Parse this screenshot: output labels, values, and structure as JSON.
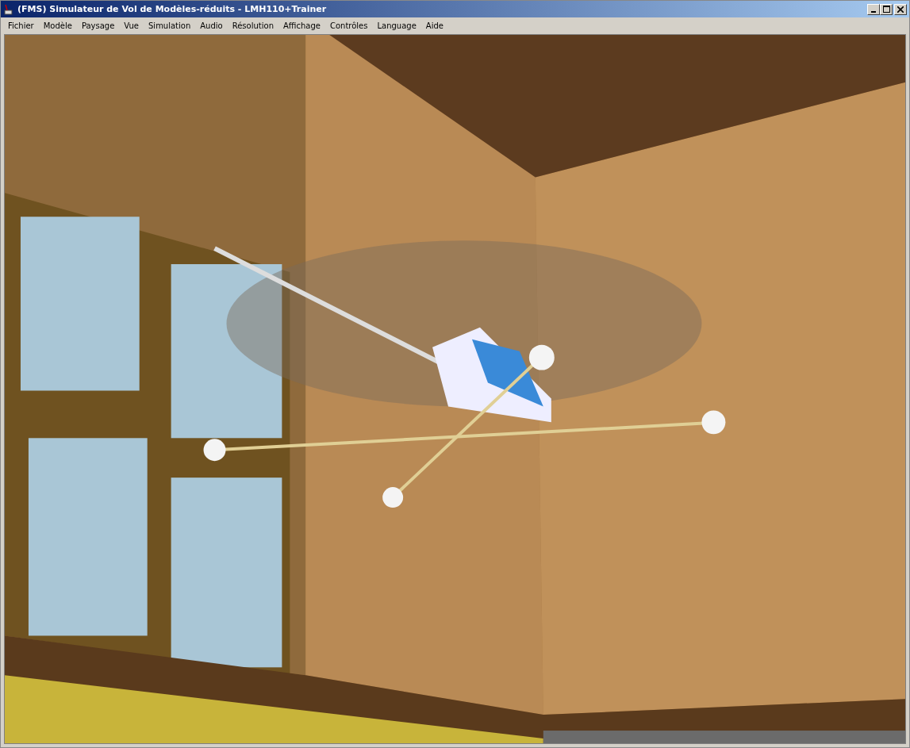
{
  "window": {
    "title": "(FMS) Simulateur de Vol de Modèles-réduits - LMH110+Trainer"
  },
  "menu": [
    "Fichier",
    "Modèle",
    "Paysage",
    "Vue",
    "Simulation",
    "Audio",
    "Résolution",
    "Affichage",
    "Contrôles",
    "Language",
    "Aide"
  ]
}
